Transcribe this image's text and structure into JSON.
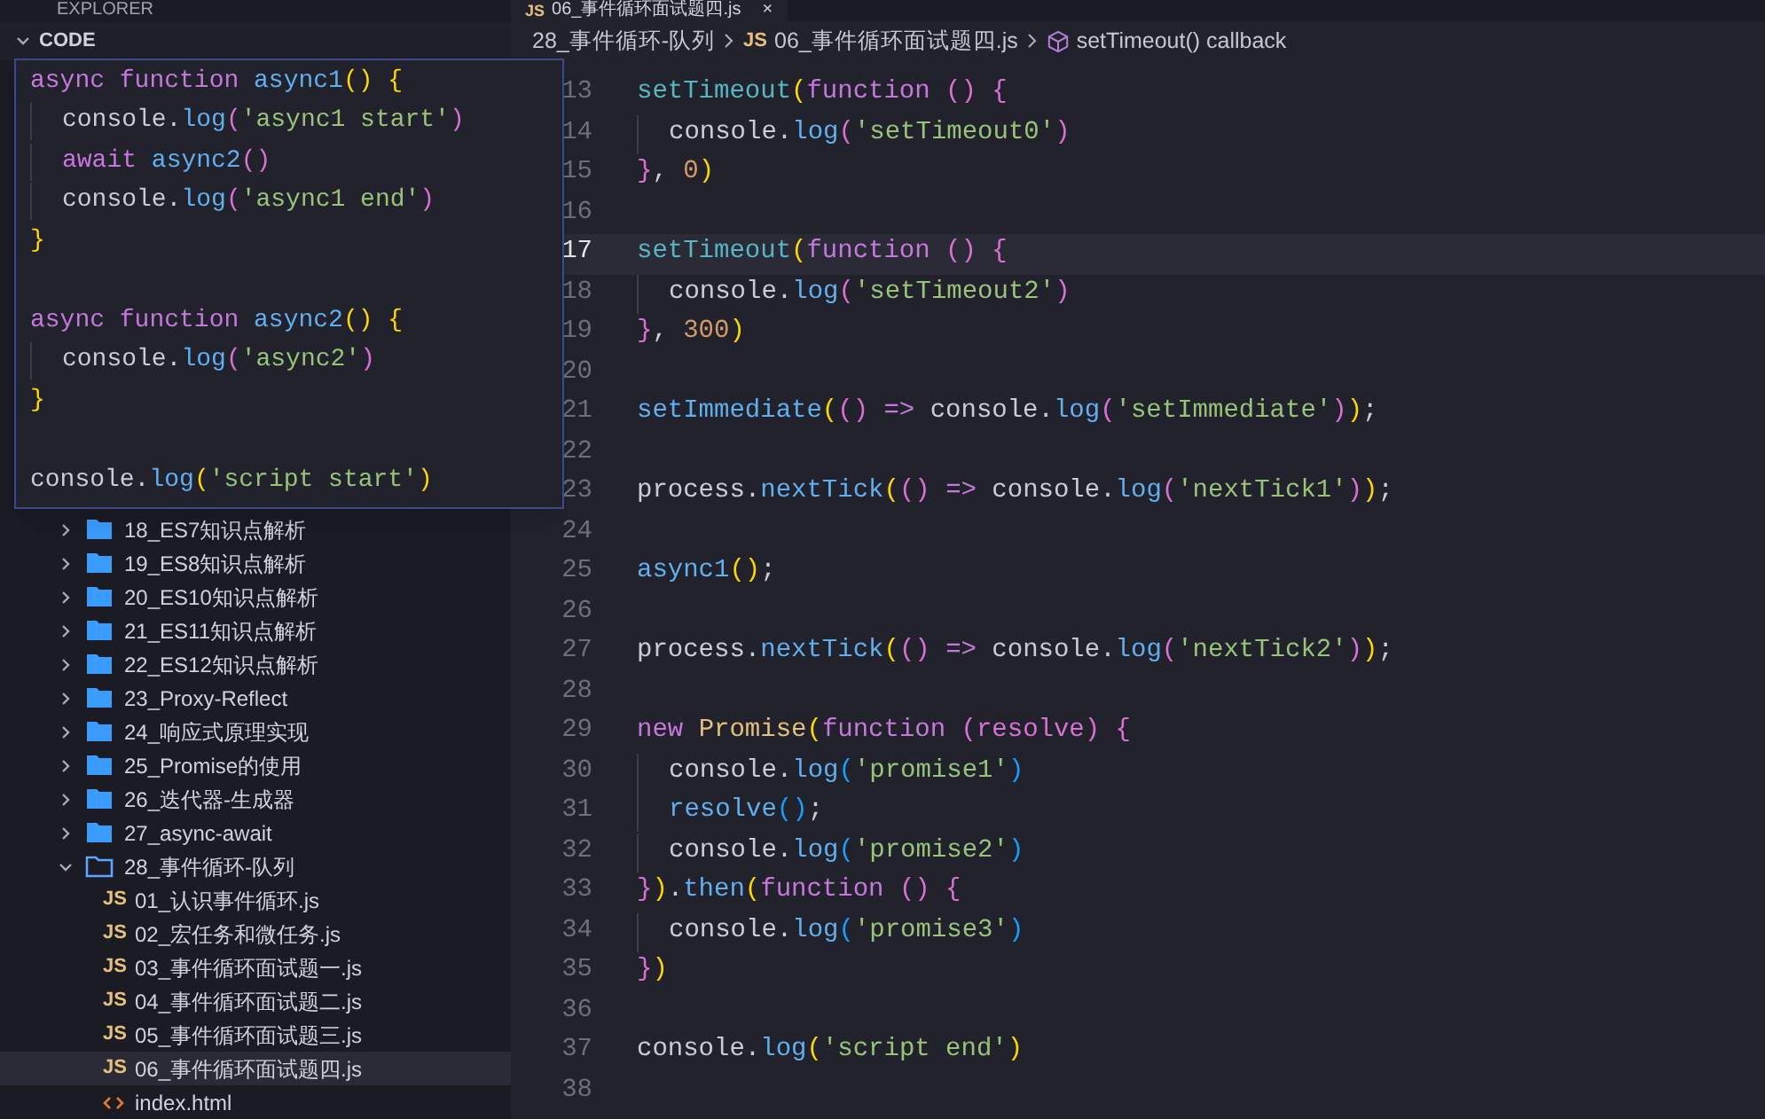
{
  "sidebar": {
    "title": "EXPLORER",
    "section": {
      "label": "CODE",
      "expanded": true
    },
    "items": [
      {
        "label": "18_ES7知识点解析",
        "kind": "folder",
        "expanded": false
      },
      {
        "label": "19_ES8知识点解析",
        "kind": "folder",
        "expanded": false
      },
      {
        "label": "20_ES10知识点解析",
        "kind": "folder",
        "expanded": false
      },
      {
        "label": "21_ES11知识点解析",
        "kind": "folder",
        "expanded": false
      },
      {
        "label": "22_ES12知识点解析",
        "kind": "folder",
        "expanded": false
      },
      {
        "label": "23_Proxy-Reflect",
        "kind": "folder",
        "expanded": false
      },
      {
        "label": "24_响应式原理实现",
        "kind": "folder",
        "expanded": false
      },
      {
        "label": "25_Promise的使用",
        "kind": "folder",
        "expanded": false
      },
      {
        "label": "26_迭代器-生成器",
        "kind": "folder",
        "expanded": false
      },
      {
        "label": "27_async-await",
        "kind": "folder",
        "expanded": false
      },
      {
        "label": "28_事件循环-队列",
        "kind": "folder",
        "expanded": true,
        "children": [
          {
            "label": "01_认识事件循环.js",
            "kind": "js",
            "badge": "JS",
            "selected": false
          },
          {
            "label": "02_宏任务和微任务.js",
            "kind": "js",
            "badge": "JS",
            "selected": false
          },
          {
            "label": "03_事件循环面试题一.js",
            "kind": "js",
            "badge": "JS",
            "selected": false
          },
          {
            "label": "04_事件循环面试题二.js",
            "kind": "js",
            "badge": "JS",
            "selected": false
          },
          {
            "label": "05_事件循环面试题三.js",
            "kind": "js",
            "badge": "JS",
            "selected": false
          },
          {
            "label": "06_事件循环面试题四.js",
            "kind": "js",
            "badge": "JS",
            "selected": true
          },
          {
            "label": "index.html",
            "kind": "html",
            "selected": false
          }
        ]
      }
    ]
  },
  "tab": {
    "badge": "JS",
    "label": "06_事件循环面试题四.js",
    "close": "×"
  },
  "breadcrumb": [
    {
      "kind": "folder",
      "label": "28_事件循环-队列"
    },
    {
      "kind": "js",
      "badge": "JS",
      "label": "06_事件循环面试题四.js"
    },
    {
      "kind": "symbol",
      "label": "setTimeout() callback"
    }
  ],
  "peek": {
    "lines": [
      {
        "kind": "code",
        "indented": false,
        "tokens": [
          {
            "kind": "kw",
            "text": "async function "
          },
          {
            "kind": "fn",
            "text": "async1"
          },
          {
            "kind": "b1",
            "text": "() {"
          }
        ]
      },
      {
        "kind": "code",
        "indented": true,
        "tokens": [
          {
            "kind": "p",
            "text": "console."
          },
          {
            "kind": "fn",
            "text": "log"
          },
          {
            "kind": "b2",
            "text": "("
          },
          {
            "kind": "str",
            "text": "'async1 start'"
          },
          {
            "kind": "b2",
            "text": ")"
          }
        ]
      },
      {
        "kind": "code",
        "indented": true,
        "tokens": [
          {
            "kind": "kw",
            "text": "await "
          },
          {
            "kind": "fn",
            "text": "async2"
          },
          {
            "kind": "b2",
            "text": "()"
          }
        ]
      },
      {
        "kind": "code",
        "indented": true,
        "tokens": [
          {
            "kind": "p",
            "text": "console."
          },
          {
            "kind": "fn",
            "text": "log"
          },
          {
            "kind": "b2",
            "text": "("
          },
          {
            "kind": "str",
            "text": "'async1 end'"
          },
          {
            "kind": "b2",
            "text": ")"
          }
        ]
      },
      {
        "kind": "code",
        "indented": false,
        "tokens": [
          {
            "kind": "b1",
            "text": "}"
          }
        ]
      },
      {
        "kind": "blank"
      },
      {
        "kind": "code",
        "indented": false,
        "tokens": [
          {
            "kind": "kw",
            "text": "async function "
          },
          {
            "kind": "fn",
            "text": "async2"
          },
          {
            "kind": "b1",
            "text": "() {"
          }
        ]
      },
      {
        "kind": "code",
        "indented": true,
        "tokens": [
          {
            "kind": "p",
            "text": "console."
          },
          {
            "kind": "fn",
            "text": "log"
          },
          {
            "kind": "b2",
            "text": "("
          },
          {
            "kind": "str",
            "text": "'async2'"
          },
          {
            "kind": "b2",
            "text": ")"
          }
        ]
      },
      {
        "kind": "code",
        "indented": false,
        "tokens": [
          {
            "kind": "b1",
            "text": "}"
          }
        ]
      },
      {
        "kind": "blank"
      },
      {
        "kind": "code",
        "indented": false,
        "tokens": [
          {
            "kind": "p",
            "text": "console."
          },
          {
            "kind": "fn",
            "text": "log"
          },
          {
            "kind": "b1",
            "text": "("
          },
          {
            "kind": "str",
            "text": "'script start'"
          },
          {
            "kind": "b1",
            "text": ")"
          }
        ]
      }
    ]
  },
  "editor": {
    "lines": [
      {
        "number": "13",
        "current": false,
        "indented": false,
        "tokens": [
          {
            "kind": "ty",
            "text": "setTimeout"
          },
          {
            "kind": "b1",
            "text": "("
          },
          {
            "kind": "kw",
            "text": "function "
          },
          {
            "kind": "b2",
            "text": "() {"
          }
        ]
      },
      {
        "number": "14",
        "current": false,
        "indented": true,
        "tokens": [
          {
            "kind": "p",
            "text": "console."
          },
          {
            "kind": "fn",
            "text": "log"
          },
          {
            "kind": "b2",
            "text": "("
          },
          {
            "kind": "str",
            "text": "'setTimeout0'"
          },
          {
            "kind": "b2",
            "text": ")"
          }
        ]
      },
      {
        "number": "15",
        "current": false,
        "indented": false,
        "tokens": [
          {
            "kind": "b2",
            "text": "}"
          },
          {
            "kind": "p",
            "text": ", "
          },
          {
            "kind": "num",
            "text": "0"
          },
          {
            "kind": "b1",
            "text": ")"
          }
        ]
      },
      {
        "number": "16",
        "current": false
      },
      {
        "number": "17",
        "current": true,
        "indented": false,
        "tokens": [
          {
            "kind": "ty",
            "text": "setTimeout"
          },
          {
            "kind": "b1",
            "text": "("
          },
          {
            "kind": "kw",
            "text": "function "
          },
          {
            "kind": "b2",
            "text": "() {"
          }
        ]
      },
      {
        "number": "18",
        "current": false,
        "indented": true,
        "tokens": [
          {
            "kind": "p",
            "text": "console."
          },
          {
            "kind": "fn",
            "text": "log"
          },
          {
            "kind": "b2",
            "text": "("
          },
          {
            "kind": "str",
            "text": "'setTimeout2'"
          },
          {
            "kind": "b2",
            "text": ")"
          }
        ]
      },
      {
        "number": "19",
        "current": false,
        "indented": false,
        "tokens": [
          {
            "kind": "b2",
            "text": "}"
          },
          {
            "kind": "p",
            "text": ", "
          },
          {
            "kind": "num",
            "text": "300"
          },
          {
            "kind": "b1",
            "text": ")"
          }
        ]
      },
      {
        "number": "20",
        "current": false
      },
      {
        "number": "21",
        "current": false,
        "indented": false,
        "tokens": [
          {
            "kind": "fn",
            "text": "setImmediate"
          },
          {
            "kind": "b1",
            "text": "("
          },
          {
            "kind": "b2",
            "text": "() "
          },
          {
            "kind": "kw",
            "text": "=> "
          },
          {
            "kind": "p",
            "text": "console."
          },
          {
            "kind": "fn",
            "text": "log"
          },
          {
            "kind": "b2",
            "text": "("
          },
          {
            "kind": "str",
            "text": "'setImmediate'"
          },
          {
            "kind": "b2",
            "text": ")"
          },
          {
            "kind": "b1",
            "text": ")"
          },
          {
            "kind": "p",
            "text": ";"
          }
        ]
      },
      {
        "number": "22",
        "current": false
      },
      {
        "number": "23",
        "current": false,
        "indented": false,
        "tokens": [
          {
            "kind": "p",
            "text": "process."
          },
          {
            "kind": "fn",
            "text": "nextTick"
          },
          {
            "kind": "b1",
            "text": "("
          },
          {
            "kind": "b2",
            "text": "() "
          },
          {
            "kind": "kw",
            "text": "=> "
          },
          {
            "kind": "p",
            "text": "console."
          },
          {
            "kind": "fn",
            "text": "log"
          },
          {
            "kind": "b2",
            "text": "("
          },
          {
            "kind": "str",
            "text": "'nextTick1'"
          },
          {
            "kind": "b2",
            "text": ")"
          },
          {
            "kind": "b1",
            "text": ")"
          },
          {
            "kind": "p",
            "text": ";"
          }
        ]
      },
      {
        "number": "24",
        "current": false
      },
      {
        "number": "25",
        "current": false,
        "indented": false,
        "tokens": [
          {
            "kind": "fn",
            "text": "async1"
          },
          {
            "kind": "b1",
            "text": "()"
          },
          {
            "kind": "p",
            "text": ";"
          }
        ]
      },
      {
        "number": "26",
        "current": false
      },
      {
        "number": "27",
        "current": false,
        "indented": false,
        "tokens": [
          {
            "kind": "p",
            "text": "process."
          },
          {
            "kind": "fn",
            "text": "nextTick"
          },
          {
            "kind": "b1",
            "text": "("
          },
          {
            "kind": "b2",
            "text": "() "
          },
          {
            "kind": "kw",
            "text": "=> "
          },
          {
            "kind": "p",
            "text": "console."
          },
          {
            "kind": "fn",
            "text": "log"
          },
          {
            "kind": "b2",
            "text": "("
          },
          {
            "kind": "str",
            "text": "'nextTick2'"
          },
          {
            "kind": "b2",
            "text": ")"
          },
          {
            "kind": "b1",
            "text": ")"
          },
          {
            "kind": "p",
            "text": ";"
          }
        ]
      },
      {
        "number": "28",
        "current": false
      },
      {
        "number": "29",
        "current": false,
        "indented": false,
        "tokens": [
          {
            "kind": "kw",
            "text": "new "
          },
          {
            "kind": "cls",
            "text": "Promise"
          },
          {
            "kind": "b1",
            "text": "("
          },
          {
            "kind": "kw",
            "text": "function "
          },
          {
            "kind": "b2",
            "text": "(resolve) {"
          }
        ]
      },
      {
        "number": "30",
        "current": false,
        "indented": true,
        "tokens": [
          {
            "kind": "p",
            "text": "console."
          },
          {
            "kind": "fn",
            "text": "log"
          },
          {
            "kind": "b3",
            "text": "("
          },
          {
            "kind": "str",
            "text": "'promise1'"
          },
          {
            "kind": "b3",
            "text": ")"
          }
        ]
      },
      {
        "number": "31",
        "current": false,
        "indented": true,
        "tokens": [
          {
            "kind": "fn",
            "text": "resolve"
          },
          {
            "kind": "b3",
            "text": "()"
          },
          {
            "kind": "p",
            "text": ";"
          }
        ]
      },
      {
        "number": "32",
        "current": false,
        "indented": true,
        "tokens": [
          {
            "kind": "p",
            "text": "console."
          },
          {
            "kind": "fn",
            "text": "log"
          },
          {
            "kind": "b3",
            "text": "("
          },
          {
            "kind": "str",
            "text": "'promise2'"
          },
          {
            "kind": "b3",
            "text": ")"
          }
        ]
      },
      {
        "number": "33",
        "current": false,
        "indented": false,
        "tokens": [
          {
            "kind": "b2",
            "text": "}"
          },
          {
            "kind": "b1",
            "text": ")"
          },
          {
            "kind": "p",
            "text": "."
          },
          {
            "kind": "fn",
            "text": "then"
          },
          {
            "kind": "b1",
            "text": "("
          },
          {
            "kind": "kw",
            "text": "function "
          },
          {
            "kind": "b2",
            "text": "() {"
          }
        ]
      },
      {
        "number": "34",
        "current": false,
        "indented": true,
        "tokens": [
          {
            "kind": "p",
            "text": "console."
          },
          {
            "kind": "fn",
            "text": "log"
          },
          {
            "kind": "b3",
            "text": "("
          },
          {
            "kind": "str",
            "text": "'promise3'"
          },
          {
            "kind": "b3",
            "text": ")"
          }
        ]
      },
      {
        "number": "35",
        "current": false,
        "indented": false,
        "tokens": [
          {
            "kind": "b2",
            "text": "}"
          },
          {
            "kind": "b1",
            "text": ")"
          }
        ]
      },
      {
        "number": "36",
        "current": false
      },
      {
        "number": "37",
        "current": false,
        "indented": false,
        "tokens": [
          {
            "kind": "p",
            "text": "console."
          },
          {
            "kind": "fn",
            "text": "log"
          },
          {
            "kind": "b1",
            "text": "("
          },
          {
            "kind": "str",
            "text": "'script end'"
          },
          {
            "kind": "b1",
            "text": ")"
          }
        ]
      },
      {
        "number": "38",
        "current": false
      }
    ]
  }
}
